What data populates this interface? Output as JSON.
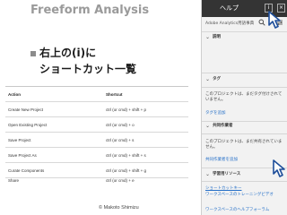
{
  "slide": {
    "title": "Freeform Analysis",
    "subtitle_line1": "右上の(i)に",
    "subtitle_line2": "ショートカット一覧",
    "copyright": "© Makoto Shimizu"
  },
  "shortcut_table": {
    "headers": [
      "Action",
      "Shortcut"
    ],
    "rows": [
      [
        "Create New Project",
        "ctrl (or cmd) + shift + p"
      ],
      [
        "Open Existing Project",
        "ctrl (or cmd) + o"
      ],
      [
        "Save Project",
        "ctrl (or cmd) + s"
      ],
      [
        "Save Project As",
        "ctrl (or cmd) + shift + s"
      ],
      [
        "Curate Components",
        "ctrl (or cmd) + shift + g"
      ],
      [
        "Share",
        "ctrl (or cmd) + e"
      ]
    ]
  },
  "help_panel": {
    "title": "ヘルプ",
    "close_label": "×",
    "search_text": "Adobe Analytics用語事典",
    "sections": {
      "description": {
        "label": "説明"
      },
      "tags": {
        "label": "タグ",
        "body": "このプロジェクトは、まだタグ付けされていません。",
        "link": "タグを追加"
      },
      "shared_users": {
        "label": "共同作業者",
        "body": "このプロジェクトは、まだ共有されていません。",
        "link": "共同作業者を追加"
      },
      "learning": {
        "label": "学習用リソース",
        "links": [
          "ショートカットキー",
          "ワークスペースのトレーニングビデオ",
          "ワークスペースのヘルプフォーラム"
        ]
      }
    }
  },
  "colors": {
    "panel_header": "#343434",
    "link": "#2670c8",
    "title_gray": "#9a9a9a"
  }
}
